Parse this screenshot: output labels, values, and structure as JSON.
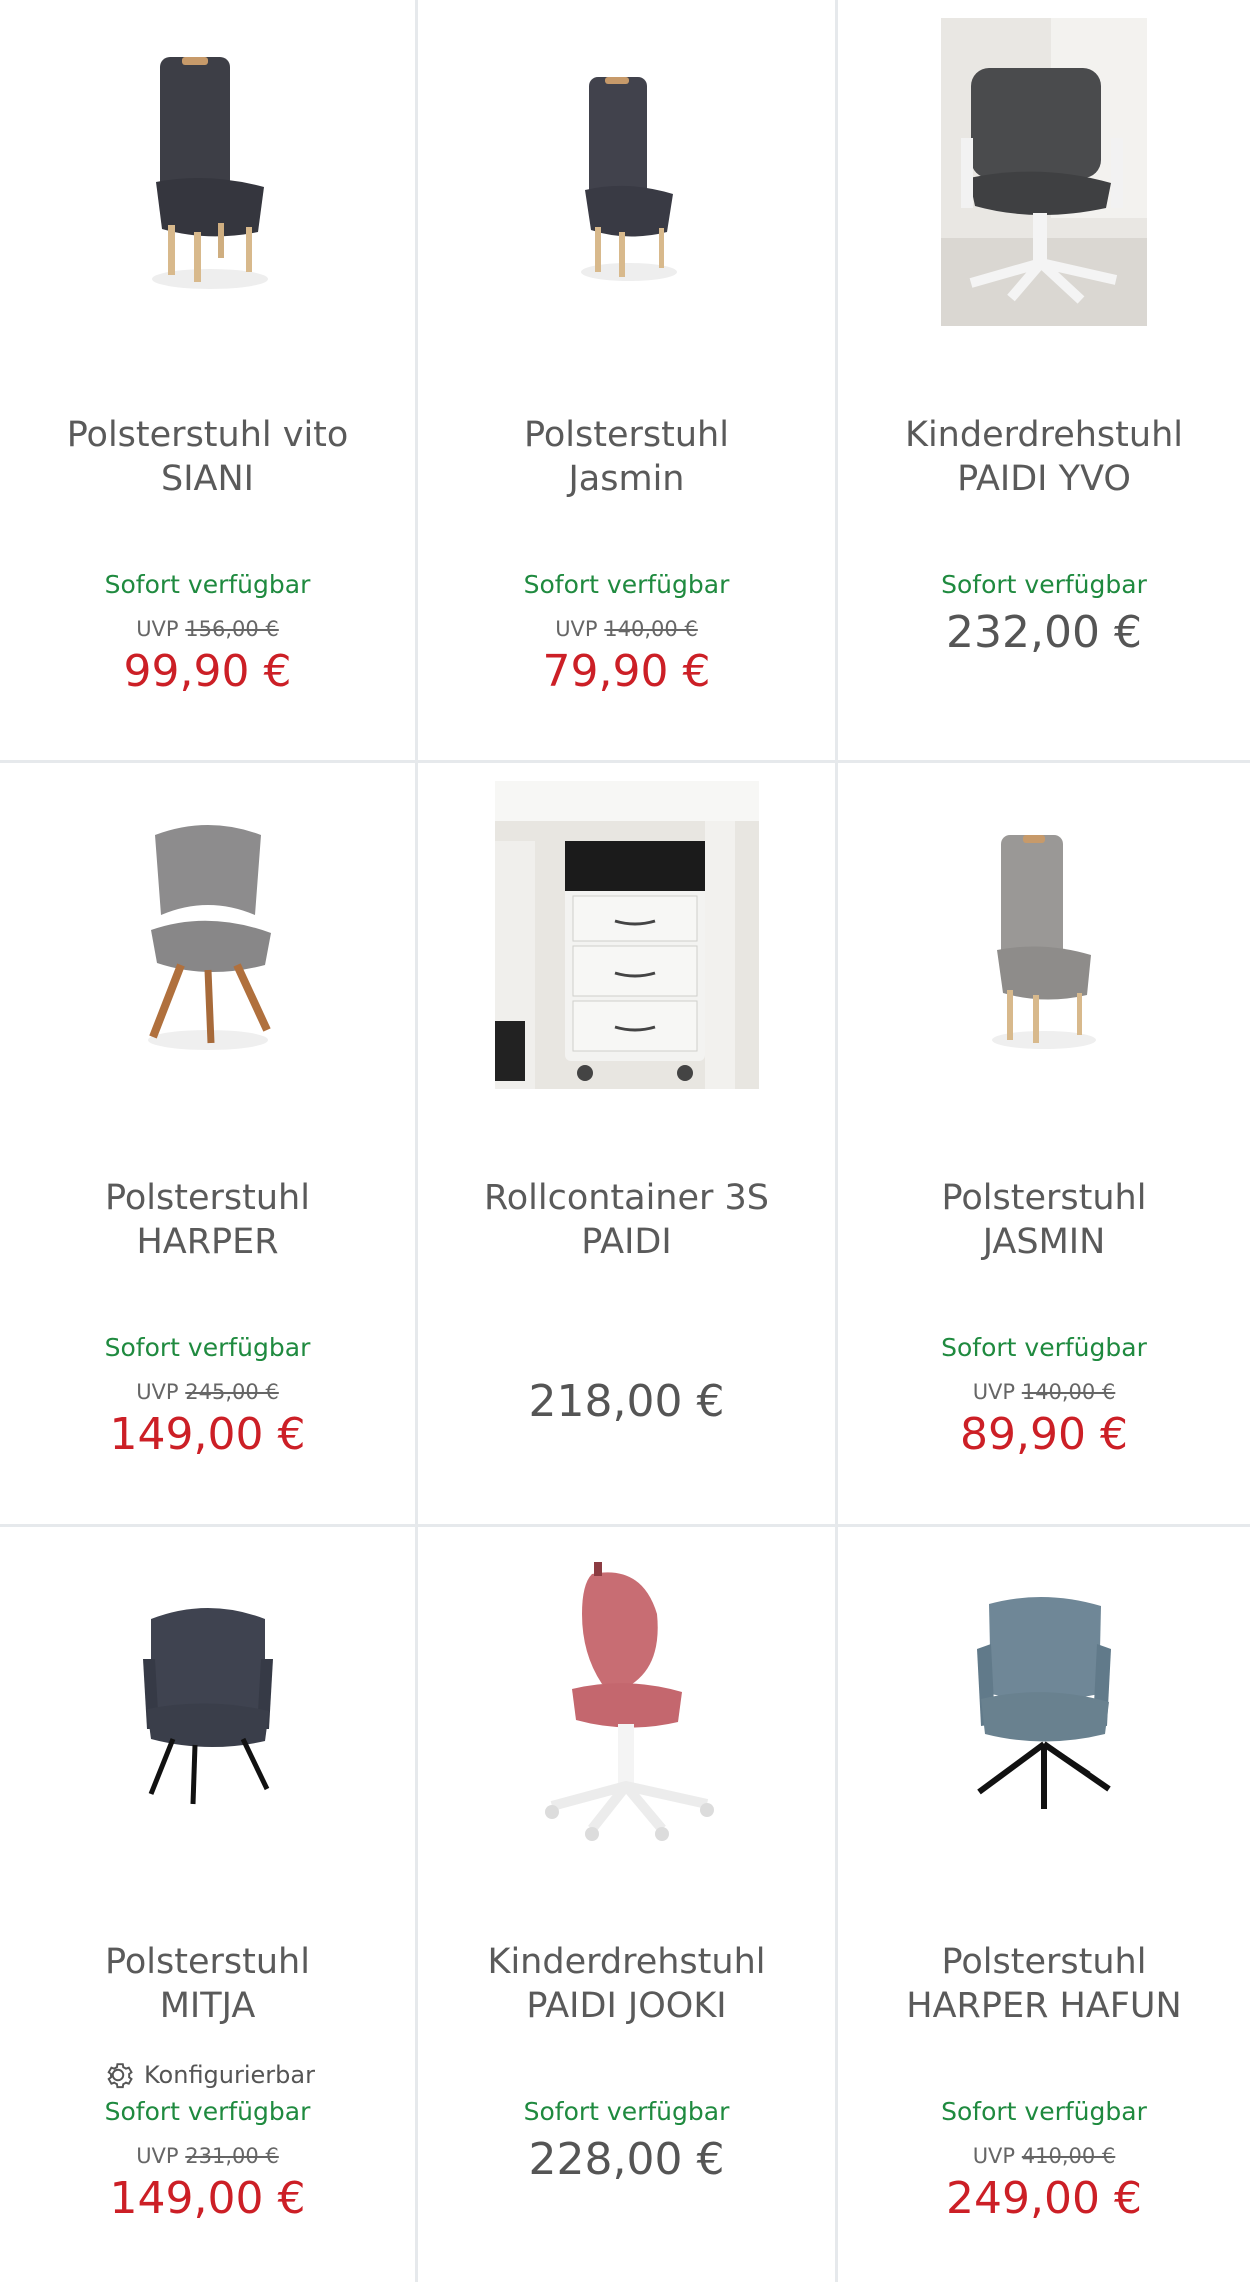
{
  "products": [
    {
      "title_line1": "Polsterstuhl vito",
      "title_line2": "SIANI",
      "availability": "Sofort verfügbar",
      "uvp_label": "UVP",
      "uvp_value": "156,00 €",
      "price": "99,90 €",
      "on_sale": true,
      "image": "dark-upholstered-chair"
    },
    {
      "title_line1": "Polsterstuhl",
      "title_line2": "Jasmin",
      "availability": "Sofort verfügbar",
      "uvp_label": "UVP",
      "uvp_value": "140,00 €",
      "price": "79,90 €",
      "on_sale": true,
      "image": "dark-upholstered-chair"
    },
    {
      "title_line1": "Kinderdrehstuhl",
      "title_line2": "PAIDI YVO",
      "availability": "Sofort verfügbar",
      "price": "232,00 €",
      "on_sale": false,
      "image": "kids-swivel-chair-dark"
    },
    {
      "title_line1": "Polsterstuhl",
      "title_line2": "HARPER",
      "availability": "Sofort verfügbar",
      "uvp_label": "UVP",
      "uvp_value": "245,00 €",
      "price": "149,00 €",
      "on_sale": true,
      "image": "grey-chair-wood-legs"
    },
    {
      "title_line1": "Rollcontainer 3S",
      "title_line2": "PAIDI",
      "price": "218,00 €",
      "on_sale": false,
      "image": "white-rolling-container"
    },
    {
      "title_line1": "Polsterstuhl",
      "title_line2": "JASMIN",
      "availability": "Sofort verfügbar",
      "uvp_label": "UVP",
      "uvp_value": "140,00 €",
      "price": "89,90 €",
      "on_sale": true,
      "image": "grey-upholstered-chair"
    },
    {
      "title_line1": "Polsterstuhl",
      "title_line2": "MITJA",
      "configurable_label": "Konfigurierbar",
      "availability": "Sofort verfügbar",
      "uvp_label": "UVP",
      "uvp_value": "231,00 €",
      "price": "149,00 €",
      "on_sale": true,
      "image": "dark-armchair-black-legs"
    },
    {
      "title_line1": "Kinderdrehstuhl",
      "title_line2": "PAIDI JOOKI",
      "availability": "Sofort verfügbar",
      "price": "228,00 €",
      "on_sale": false,
      "image": "kids-swivel-chair-pink"
    },
    {
      "title_line1": "Polsterstuhl",
      "title_line2": "HARPER HAFUN",
      "availability": "Sofort verfügbar",
      "uvp_label": "UVP",
      "uvp_value": "410,00 €",
      "price": "249,00 €",
      "on_sale": true,
      "image": "blue-armchair-cross-legs"
    }
  ],
  "colors": {
    "sale_price": "#cc1f26",
    "availability": "#1f8a3f",
    "regular_price": "#555555",
    "divider": "#e6e9ec"
  }
}
